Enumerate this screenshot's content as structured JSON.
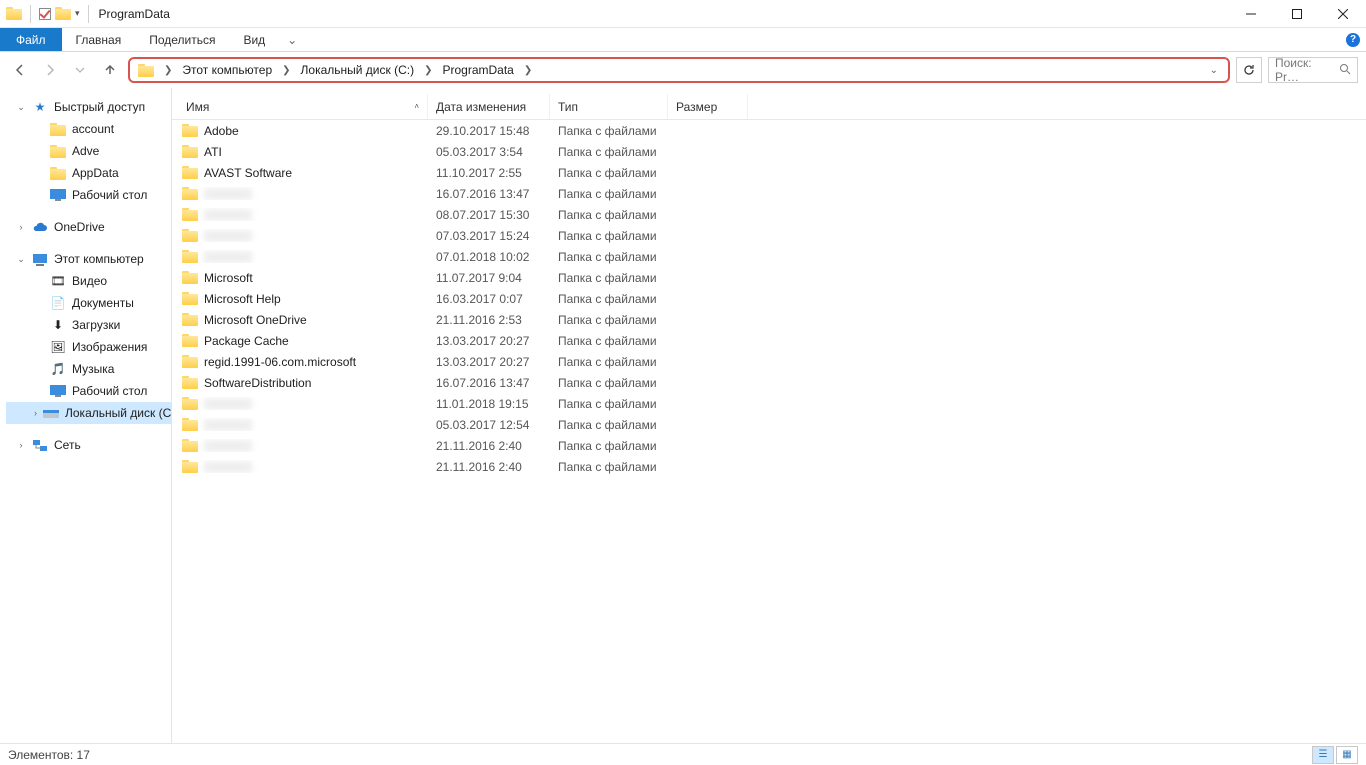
{
  "window": {
    "title": "ProgramData"
  },
  "ribbon": {
    "file": "Файл",
    "tabs": [
      "Главная",
      "Поделиться",
      "Вид"
    ]
  },
  "breadcrumbs": [
    "Этот компьютер",
    "Локальный диск (C:)",
    "ProgramData"
  ],
  "search": {
    "placeholder": "Поиск: Pr…"
  },
  "columns": {
    "name": "Имя",
    "date": "Дата изменения",
    "type": "Тип",
    "size": "Размер"
  },
  "tree": {
    "quick": {
      "label": "Быстрый доступ",
      "items": [
        "account",
        "Adve",
        "AppData",
        "Рабочий стол"
      ]
    },
    "onedrive": "OneDrive",
    "pc": {
      "label": "Этот компьютер",
      "items": [
        "Видео",
        "Документы",
        "Загрузки",
        "Изображения",
        "Музыка",
        "Рабочий стол",
        "Локальный диск (C:)"
      ]
    },
    "network": "Сеть"
  },
  "rows": [
    {
      "name": "Adobe",
      "date": "29.10.2017 15:48",
      "type": "Папка с файлами"
    },
    {
      "name": "ATI",
      "date": "05.03.2017 3:54",
      "type": "Папка с файлами"
    },
    {
      "name": "AVAST Software",
      "date": "11.10.2017 2:55",
      "type": "Папка с файлами"
    },
    {
      "name": "",
      "date": "16.07.2016 13:47",
      "type": "Папка с файлами",
      "redacted": true
    },
    {
      "name": "",
      "date": "08.07.2017 15:30",
      "type": "Папка с файлами",
      "redacted": true
    },
    {
      "name": "",
      "date": "07.03.2017 15:24",
      "type": "Папка с файлами",
      "redacted": true
    },
    {
      "name": "",
      "date": "07.01.2018 10:02",
      "type": "Папка с файлами",
      "redacted": true
    },
    {
      "name": "Microsoft",
      "date": "11.07.2017 9:04",
      "type": "Папка с файлами"
    },
    {
      "name": "Microsoft Help",
      "date": "16.03.2017 0:07",
      "type": "Папка с файлами"
    },
    {
      "name": "Microsoft OneDrive",
      "date": "21.11.2016 2:53",
      "type": "Папка с файлами"
    },
    {
      "name": "Package Cache",
      "date": "13.03.2017 20:27",
      "type": "Папка с файлами"
    },
    {
      "name": "regid.1991-06.com.microsoft",
      "date": "13.03.2017 20:27",
      "type": "Папка с файлами"
    },
    {
      "name": "SoftwareDistribution",
      "date": "16.07.2016 13:47",
      "type": "Папка с файлами"
    },
    {
      "name": "",
      "date": "11.01.2018 19:15",
      "type": "Папка с файлами",
      "redacted": true
    },
    {
      "name": "",
      "date": "05.03.2017 12:54",
      "type": "Папка с файлами",
      "redacted": true
    },
    {
      "name": "",
      "date": "21.11.2016 2:40",
      "type": "Папка с файлами",
      "redacted": true
    },
    {
      "name": "",
      "date": "21.11.2016 2:40",
      "type": "Папка с файлами",
      "redacted": true
    }
  ],
  "status": {
    "text": "Элементов: 17"
  }
}
